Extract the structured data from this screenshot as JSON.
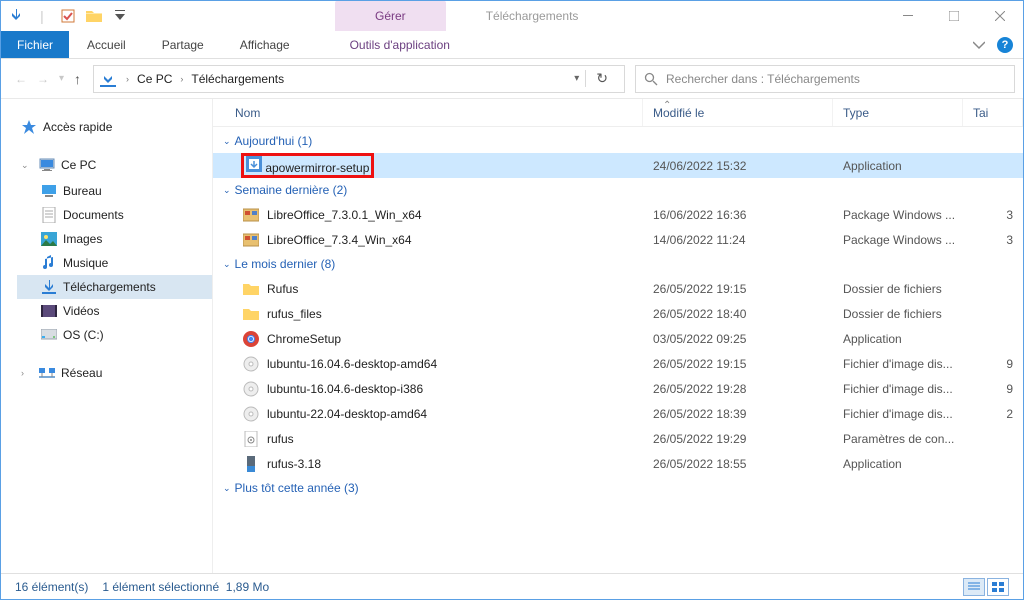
{
  "window": {
    "context_tab": "Gérer",
    "title": "Téléchargements"
  },
  "ribbon": {
    "file": "Fichier",
    "tabs": [
      "Accueil",
      "Partage",
      "Affichage"
    ],
    "context_tool": "Outils d'application"
  },
  "address": {
    "crumbs": [
      "Ce PC",
      "Téléchargements"
    ]
  },
  "search": {
    "placeholder": "Rechercher dans : Téléchargements"
  },
  "nav": {
    "quick": "Accès rapide",
    "thispc": "Ce PC",
    "children": [
      "Bureau",
      "Documents",
      "Images",
      "Musique",
      "Téléchargements",
      "Vidéos",
      "OS (C:)"
    ],
    "network": "Réseau",
    "selected": "Téléchargements"
  },
  "columns": {
    "name": "Nom",
    "modified": "Modifié le",
    "type": "Type",
    "size": "Tai"
  },
  "groups": [
    {
      "label": "Aujourd'hui (1)",
      "rows": [
        {
          "icon": "installer",
          "name": "apowermirror-setup",
          "mod": "24/06/2022 15:32",
          "type": "Application",
          "size": "",
          "selected": true,
          "highlighted": true
        }
      ]
    },
    {
      "label": "Semaine dernière (2)",
      "rows": [
        {
          "icon": "msi",
          "name": "LibreOffice_7.3.0.1_Win_x64",
          "mod": "16/06/2022 16:36",
          "type": "Package Windows ...",
          "size": "3"
        },
        {
          "icon": "msi",
          "name": "LibreOffice_7.3.4_Win_x64",
          "mod": "14/06/2022 11:24",
          "type": "Package Windows ...",
          "size": "3"
        }
      ]
    },
    {
      "label": "Le mois dernier (8)",
      "rows": [
        {
          "icon": "folder",
          "name": "Rufus",
          "mod": "26/05/2022 19:15",
          "type": "Dossier de fichiers",
          "size": ""
        },
        {
          "icon": "folder",
          "name": "rufus_files",
          "mod": "26/05/2022 18:40",
          "type": "Dossier de fichiers",
          "size": ""
        },
        {
          "icon": "chrome",
          "name": "ChromeSetup",
          "mod": "03/05/2022 09:25",
          "type": "Application",
          "size": ""
        },
        {
          "icon": "iso",
          "name": "lubuntu-16.04.6-desktop-amd64",
          "mod": "26/05/2022 19:15",
          "type": "Fichier d'image dis...",
          "size": "9"
        },
        {
          "icon": "iso",
          "name": "lubuntu-16.04.6-desktop-i386",
          "mod": "26/05/2022 19:28",
          "type": "Fichier d'image dis...",
          "size": "9"
        },
        {
          "icon": "iso",
          "name": "lubuntu-22.04-desktop-amd64",
          "mod": "26/05/2022 18:39",
          "type": "Fichier d'image dis...",
          "size": "2"
        },
        {
          "icon": "cfg",
          "name": "rufus",
          "mod": "26/05/2022 19:29",
          "type": "Paramètres de con...",
          "size": ""
        },
        {
          "icon": "rufus",
          "name": "rufus-3.18",
          "mod": "26/05/2022 18:55",
          "type": "Application",
          "size": ""
        }
      ]
    },
    {
      "label": "Plus tôt cette année (3)",
      "rows": []
    }
  ],
  "status": {
    "count": "16 élément(s)",
    "selection": "1 élément sélectionné",
    "size": "1,89 Mo"
  }
}
